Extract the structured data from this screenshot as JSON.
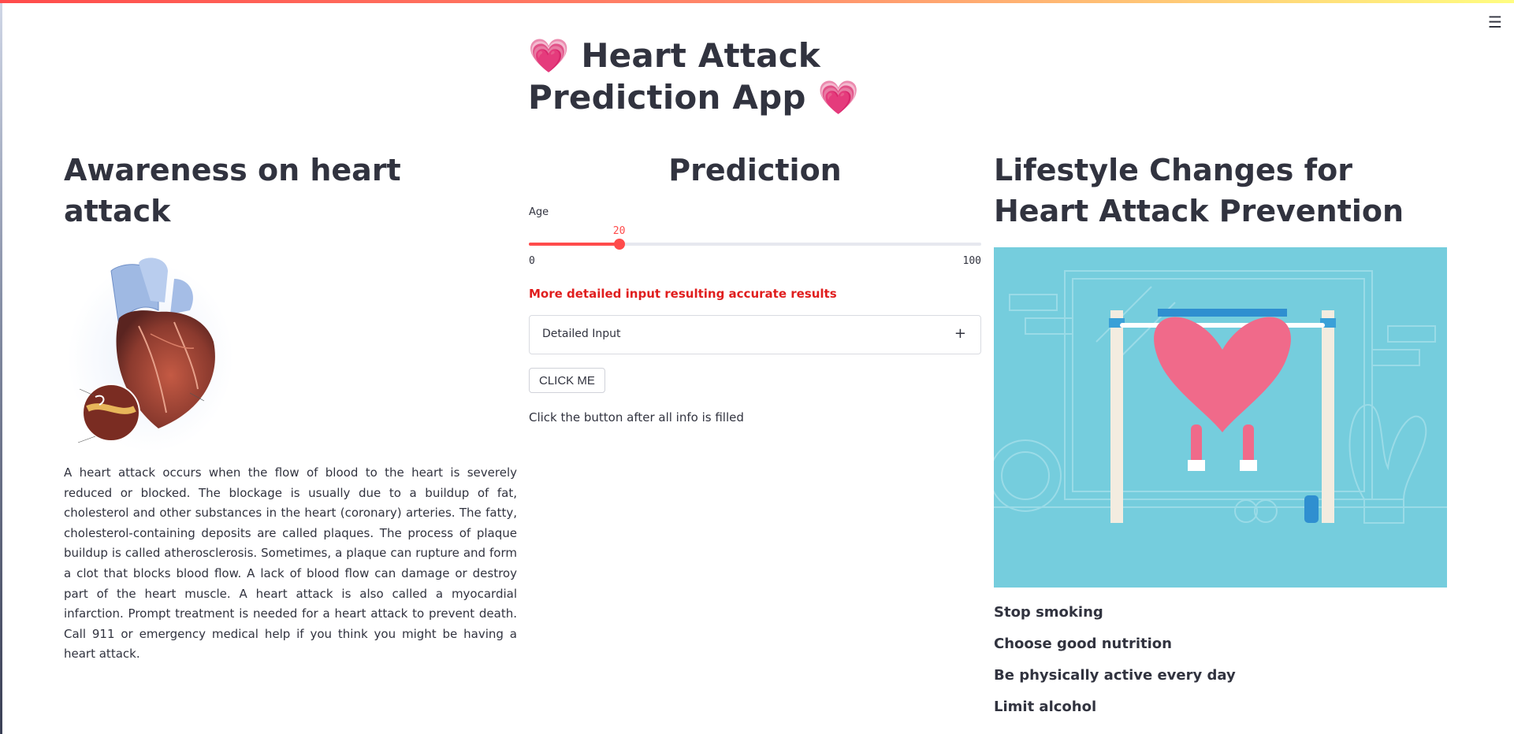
{
  "app": {
    "title": "💗 Heart Attack Prediction App 💗",
    "menu_icon": "hamburger-menu-icon",
    "accent_color": "#ff4b4b"
  },
  "awareness": {
    "heading": "Awareness on heart attack",
    "body": "A heart attack occurs when the flow of blood to the heart is severely reduced or blocked. The blockage is usually due to a buildup of fat, cholesterol and other substances in the heart (coronary) arteries. The fatty, cholesterol-containing deposits are called plaques. The process of plaque buildup is called atherosclerosis. Sometimes, a plaque can rupture and form a clot that blocks blood flow. A lack of blood flow can damage or destroy part of the heart muscle. A heart attack is also called a myocardial infarction. Prompt treatment is needed for a heart attack to prevent death. Call 911 or emergency medical help if you think you might be having a heart attack."
  },
  "prediction": {
    "heading": "Prediction",
    "age": {
      "label": "Age",
      "value": 20,
      "min": 0,
      "max": 100
    },
    "hint": "More detailed input resulting accurate results",
    "expander": {
      "label": "Detailed Input",
      "icon": "+"
    },
    "button_label": "CLICK ME",
    "caption": "Click the button after all info is filled"
  },
  "lifestyle": {
    "heading": "Lifestyle Changes for Heart Attack Prevention",
    "tips": [
      "Stop smoking",
      "Choose good nutrition",
      "Be physically active every day",
      "Limit alcohol"
    ]
  }
}
